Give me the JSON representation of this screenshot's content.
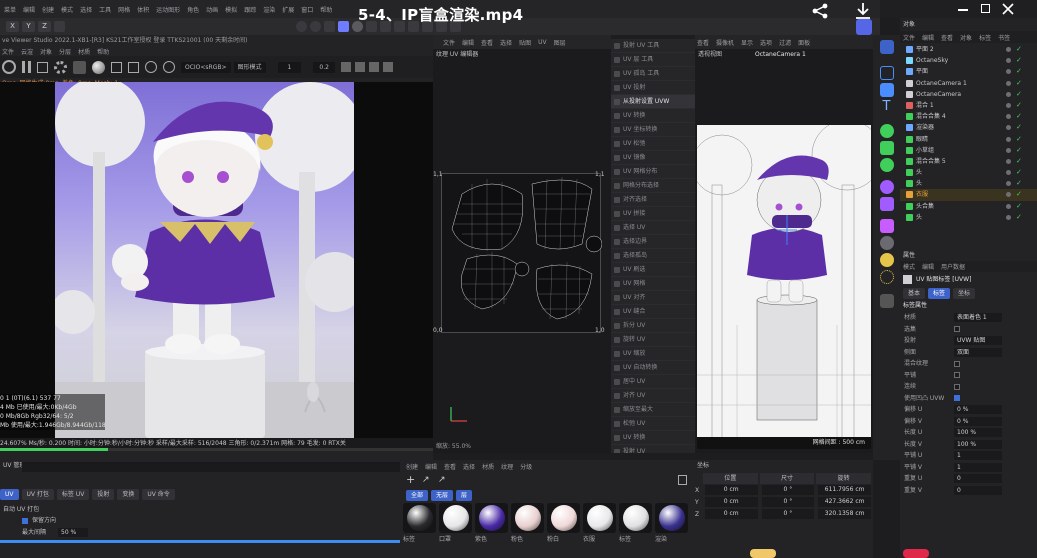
{
  "video": {
    "title": "5-4、IP盲盒渲染.mp4"
  },
  "topbar": {
    "menu": [
      "菜单",
      "编辑",
      "创建",
      "模式",
      "选择",
      "工具",
      "网格",
      "体积",
      "运动图形",
      "角色",
      "动画",
      "模拟",
      "跟踪",
      "渲染",
      "扩展",
      "窗口",
      "帮助"
    ],
    "xyz": [
      "X",
      "Y",
      "Z"
    ]
  },
  "left_viewer": {
    "title": "ve Viewer Studio 2022.1-XB1-[R3]  KS21工作室授权  登录 TTKS21001 (00 天剩余时间)",
    "menu": [
      "文件",
      "云渲",
      "对象",
      "分层",
      "材质",
      "帮助"
    ],
    "mode_select": "OCIO<sRGB>",
    "mode_select2": "图形模式",
    "num1": "1",
    "num2": "0.2",
    "status_top": "Oms, 网格生成:0ms, 着色: 0ms, Mesh: 1",
    "stats": [
      "0 1 (0T)(6.1)   537      77",
      "4 Mb 已使用/最大:0Kb/4Gb",
      "0 Mb/8Gb  Rgb32/64: 5/2",
      "Mb 使用/最大:1.946Gb/8.944Gb/118Gb"
    ],
    "bottom_status": "24.607%  Ms/秒: 0.200  时间: 小时:分钟:秒/小时:分钟:秒  采样/最大采样: 516/2048  三角形: 0/2.371m  网格: 79  毛发: 0  RTX关"
  },
  "uv_editor": {
    "menu": [
      "文件",
      "编辑",
      "查看",
      "选择",
      "贴图",
      "UV",
      "图层"
    ],
    "label": "纹理 UV 编辑器",
    "corner_tl": "1,1",
    "corner_tr": "1,1",
    "corner_bl": "0,0",
    "corner_br": "1,0",
    "zoom": "缩放: 55.0%"
  },
  "uv_menu": {
    "items": [
      "投射 UV 工具",
      "UV 层 工具",
      "UV 孤岛 工具",
      "UV 投射",
      "从投射设置 UVW",
      "UV 转换",
      "UV 坐标转换",
      "UV 松弛",
      "UV 镜像",
      "UV 网格分布",
      "网格分布选择",
      "对齐选择",
      "UV 拼接",
      "选择 UV",
      "选择边界",
      "选择孤岛",
      "UV 刷选",
      "UV 网格",
      "UV 对齐",
      "UV 缝合",
      "拆分 UV",
      "旋转 UV",
      "UV 缩放",
      "UV 自动转换",
      "居中 UV",
      "对齐 UV",
      "缩放至最大",
      "松弛 UV",
      "UV 转换",
      "投射 UV",
      "投射 UV",
      "UV 拉直"
    ],
    "highlight_index": 4
  },
  "camera_view": {
    "menu": [
      "查看",
      "摄像机",
      "显示",
      "选项",
      "过滤",
      "面板"
    ],
    "label": "透视视图",
    "camera": "OctaneCamera 1",
    "grid_spacing": "网格间距 : 500 cm"
  },
  "object_manager": {
    "title": "对象",
    "menu": [
      "文件",
      "编辑",
      "查看",
      "对象",
      "标签",
      "书签"
    ],
    "objects": [
      "平面 2",
      "OctaneSky",
      "平面",
      "OctaneCamera 1",
      "OctaneCamera",
      "混合 1",
      "混合合集 4",
      "渲染器",
      "眼睛",
      "小草组",
      "混合合集 5",
      "头",
      "头",
      "衣服",
      "头合集",
      "头"
    ]
  },
  "attributes": {
    "title": "属性",
    "menu": [
      "模式",
      "编辑",
      "用户数据"
    ],
    "object_name": "UV 贴图标签 [UVW]",
    "tabs": [
      "基本",
      "标签",
      "坐标"
    ],
    "section": "标签属性",
    "rows": [
      {
        "label": "材质",
        "value": "表面着色 1"
      },
      {
        "label": "选集",
        "value": ""
      },
      {
        "label": "投射",
        "value": "UVW 贴图"
      },
      {
        "label": "侧面",
        "value": "双面"
      },
      {
        "label": "混合纹理",
        "value": ""
      },
      {
        "label": "平铺",
        "value": ""
      },
      {
        "label": "连续",
        "value": ""
      },
      {
        "label": "使用凹凸 UVW",
        "value": ""
      },
      {
        "label": "偏移 U",
        "value": "0 %"
      },
      {
        "label": "偏移 V",
        "value": "0 %"
      },
      {
        "label": "长度 U",
        "value": "100 %"
      },
      {
        "label": "长度 V",
        "value": "100 %"
      },
      {
        "label": "平铺 U",
        "value": "1"
      },
      {
        "label": "平铺 V",
        "value": "1"
      },
      {
        "label": "重复 U",
        "value": "0"
      },
      {
        "label": "重复 V",
        "value": "0"
      }
    ],
    "checkboxes": [
      false,
      false,
      false,
      false,
      true,
      true,
      true
    ]
  },
  "bottom_left": {
    "title": "UV 管理",
    "tabs": [
      "UV",
      "UV 打包",
      "标签 UV",
      "投射",
      "变换",
      "UV 命令"
    ],
    "row1": "自动 UV 打包",
    "row2": "保留方向",
    "row3_label": "最大间隔",
    "row3_value": "50 %"
  },
  "materials": {
    "menu": [
      "创建",
      "编辑",
      "查看",
      "选择",
      "材质",
      "纹理",
      "分级"
    ],
    "filters": [
      "全部",
      "无层",
      "层"
    ],
    "names": [
      "标签",
      "口罩",
      "紫色",
      "粉色",
      "粉白",
      "衣服",
      "标签",
      "渲染"
    ]
  },
  "coordinates": {
    "title": "坐标",
    "headers": [
      "位置",
      "尺寸",
      "旋转"
    ],
    "rows": [
      {
        "axis": "X",
        "pos": "0 cm",
        "rot": "0 °",
        "size": "611.7956 cm"
      },
      {
        "axis": "Y",
        "pos": "0 cm",
        "rot": "0 °",
        "size": "427.3662 cm"
      },
      {
        "axis": "Z",
        "pos": "0 cm",
        "rot": "0 °",
        "size": "320.1358 cm"
      }
    ]
  },
  "colors": {
    "accent": "#3d63c9",
    "purple": "#5c2fa6",
    "highlight_orange": "#e6a23c",
    "green": "#3fcf5a"
  }
}
